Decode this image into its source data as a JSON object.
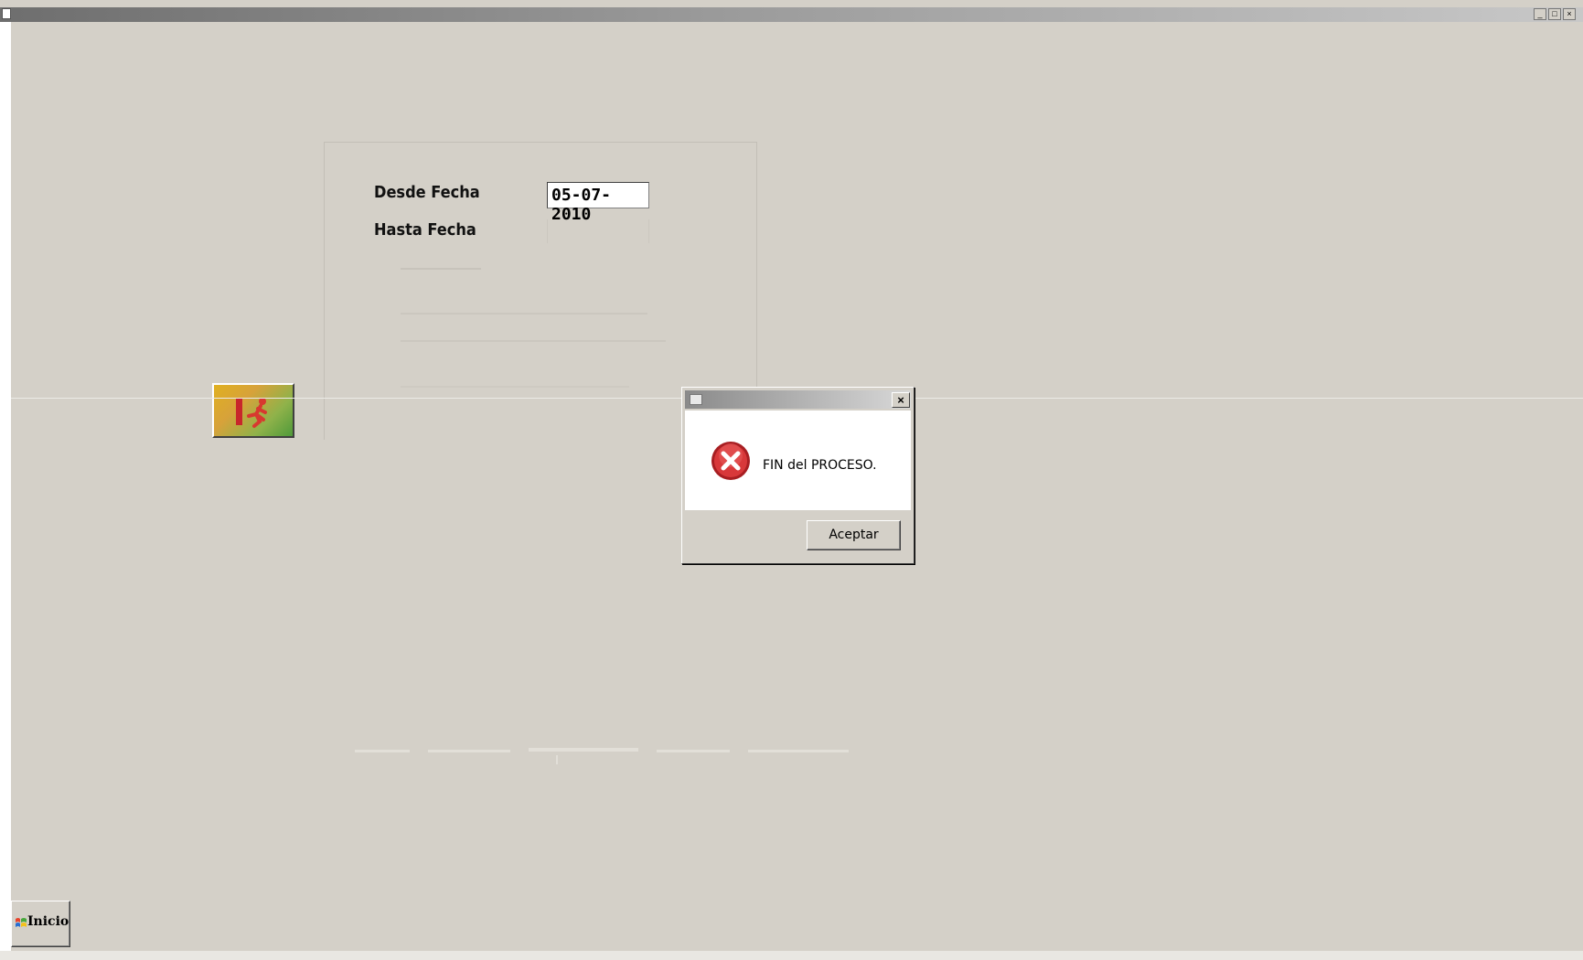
{
  "window": {
    "controls": [
      "_",
      "□",
      "×"
    ]
  },
  "form": {
    "desde_label": "Desde Fecha",
    "desde_value": "05-07-2010",
    "hasta_label": "Hasta Fecha",
    "hasta_value": ""
  },
  "exit_button": {
    "icon": "exit-door-running-man-icon"
  },
  "dialog": {
    "title": "",
    "icon": "error-icon",
    "message": "FIN del PROCESO.",
    "ok_label": "Aceptar",
    "close_label": "×"
  },
  "taskbar": {
    "start_label": "Inicio"
  },
  "colors": {
    "background": "#d4d0c8",
    "error_red": "#c8262b",
    "white": "#ffffff"
  }
}
